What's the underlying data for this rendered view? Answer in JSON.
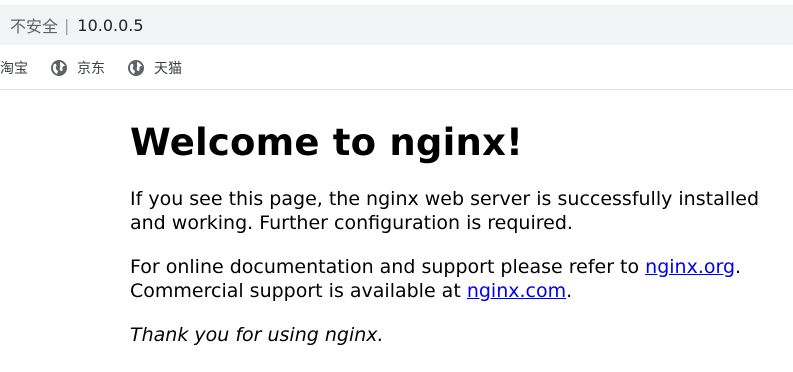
{
  "browser": {
    "omnibox": {
      "security_label": "不安全",
      "separator": "|",
      "url": "10.0.0.5"
    },
    "bookmarks": [
      {
        "label": "淘宝",
        "icon": "globe-icon"
      },
      {
        "label": "京东",
        "icon": "globe-icon"
      },
      {
        "label": "天猫",
        "icon": "globe-icon"
      }
    ]
  },
  "page": {
    "heading": "Welcome to nginx!",
    "para1": "If you see this page, the nginx web server is successfully installed and working. Further configuration is required.",
    "para2_prefix": "For online documentation and support please refer to ",
    "link_org": "nginx.org",
    "para2_mid": ".",
    "para2_line2_prefix": "Commercial support is available at ",
    "link_com": "nginx.com",
    "para2_end": ".",
    "thanks": "Thank you for using nginx."
  }
}
